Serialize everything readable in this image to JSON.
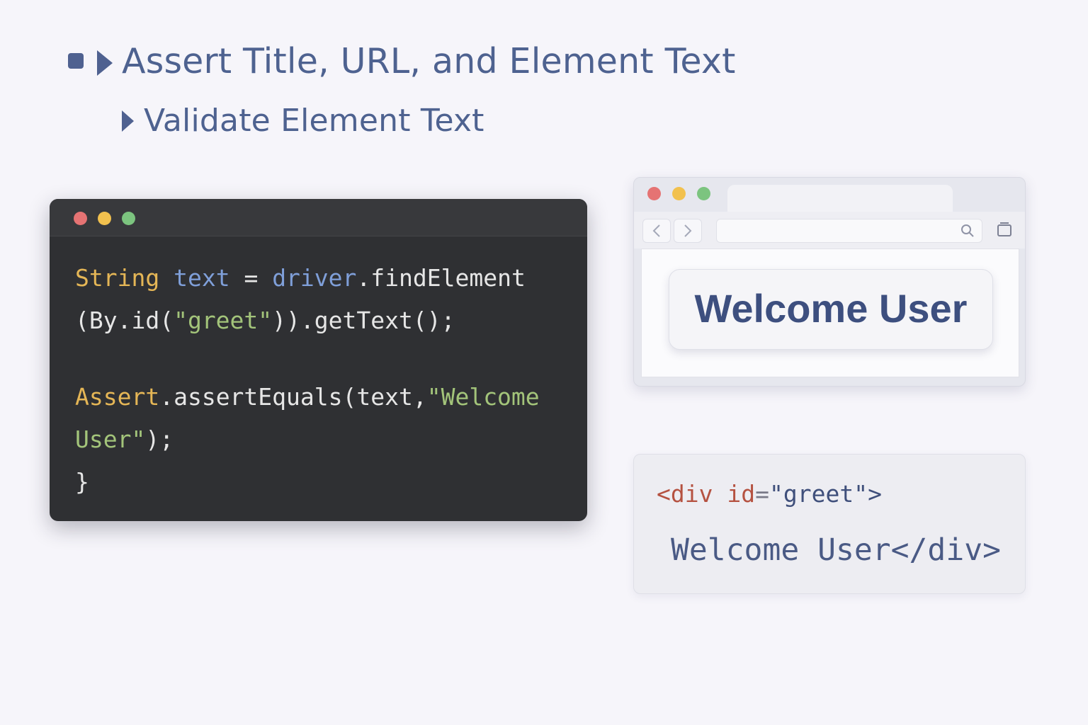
{
  "headings": {
    "main": "Assert Title, URL, and Element Text",
    "sub": "Validate Element Text"
  },
  "editor": {
    "line1": {
      "type": "String",
      "var": "text",
      "eq": " = ",
      "obj": "driver",
      "call": ".findElement"
    },
    "line2": {
      "pre": "(By.id(",
      "str": "\"greet\"",
      "post": ")).getText();"
    },
    "line3": {
      "cls": "Assert",
      "method": ".assertEquals",
      "args": "(text,",
      "str": "\"Welcome"
    },
    "line4": {
      "str": "User\"",
      "post": ");"
    },
    "line5": {
      "brace": "}"
    }
  },
  "browser": {
    "back_icon": "chevron-left-icon",
    "forward_icon": "chevron-right-icon",
    "heading_text": "Welcome User"
  },
  "snippet": {
    "open_bracket": "<",
    "tag": "div",
    "attr": "id",
    "eq": "=",
    "value": "\"greet\"",
    "close_bracket": ">",
    "content": "Welcome User</div>"
  },
  "colors": {
    "window_red": "#e57373",
    "window_yellow": "#f2c14e",
    "window_green": "#7cc47f",
    "editor_bg": "#2f3033",
    "heading": "#4e6290"
  }
}
